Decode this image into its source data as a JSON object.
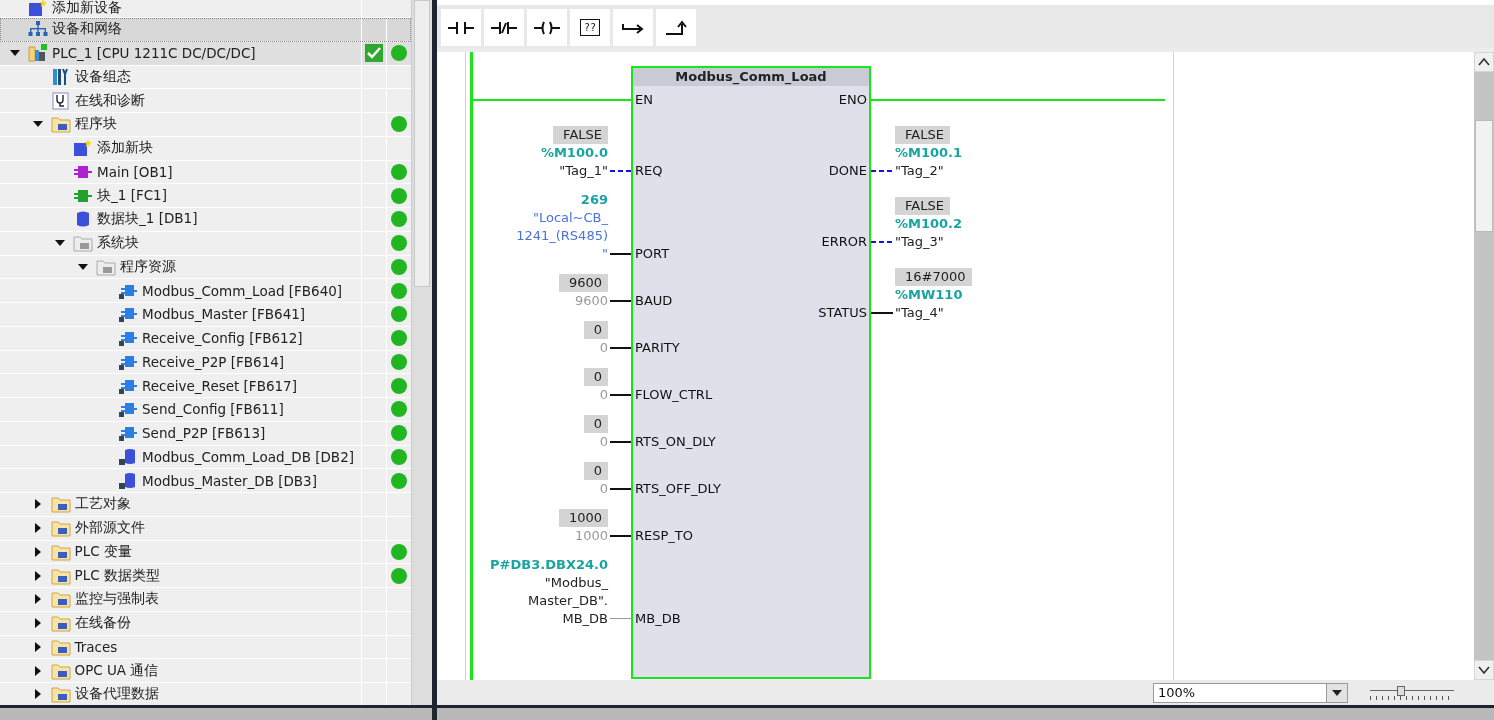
{
  "project_tree": {
    "items": [
      {
        "label": "添加新设备",
        "kind": "add",
        "selected": false
      },
      {
        "label": "设备和网络",
        "kind": "network",
        "selected": true
      },
      {
        "label": "PLC_1 [CPU 1211C DC/DC/DC]",
        "kind": "device",
        "selected": false,
        "expanded": true,
        "consistent": true,
        "online": true,
        "children": [
          {
            "label": "设备组态",
            "kind": "config",
            "selected": false
          },
          {
            "label": "在线和诊断",
            "kind": "diag",
            "selected": false
          },
          {
            "label": "程序块",
            "kind": "folder",
            "selected": false,
            "expanded": true,
            "online": true,
            "children": [
              {
                "label": "添加新块",
                "kind": "add",
                "selected": false
              },
              {
                "label": "Main [OB1]",
                "kind": "ob",
                "selected": false,
                "online": true
              },
              {
                "label": "块_1 [FC1]",
                "kind": "fc",
                "selected": false,
                "online": true
              },
              {
                "label": "数据块_1 [DB1]",
                "kind": "db",
                "selected": false,
                "online": true
              },
              {
                "label": "系统块",
                "kind": "sysfolder",
                "selected": false,
                "expanded": true,
                "online": true,
                "children": [
                  {
                    "label": "程序资源",
                    "kind": "sysfolder",
                    "selected": false,
                    "expanded": true,
                    "online": true,
                    "children": [
                      {
                        "label": "Modbus_Comm_Load [FB640]",
                        "kind": "fb",
                        "selected": false,
                        "online": true
                      },
                      {
                        "label": "Modbus_Master [FB641]",
                        "kind": "fb",
                        "selected": false,
                        "online": true
                      },
                      {
                        "label": "Receive_Config [FB612]",
                        "kind": "fb",
                        "selected": false,
                        "online": true
                      },
                      {
                        "label": "Receive_P2P [FB614]",
                        "kind": "fb",
                        "selected": false,
                        "online": true
                      },
                      {
                        "label": "Receive_Reset [FB617]",
                        "kind": "fb",
                        "selected": false,
                        "online": true
                      },
                      {
                        "label": "Send_Config [FB611]",
                        "kind": "fb",
                        "selected": false,
                        "online": true
                      },
                      {
                        "label": "Send_P2P [FB613]",
                        "kind": "fb",
                        "selected": false,
                        "online": true
                      },
                      {
                        "label": "Modbus_Comm_Load_DB [DB2]",
                        "kind": "idb",
                        "selected": false,
                        "online": true
                      },
                      {
                        "label": "Modbus_Master_DB [DB3]",
                        "kind": "idb",
                        "selected": false,
                        "online": true
                      }
                    ]
                  }
                ]
              }
            ]
          },
          {
            "label": "工艺对象",
            "kind": "folder",
            "selected": false,
            "expanded": false
          },
          {
            "label": "外部源文件",
            "kind": "folder",
            "selected": false,
            "expanded": false
          },
          {
            "label": "PLC 变量",
            "kind": "folder",
            "selected": false,
            "expanded": false,
            "online": true
          },
          {
            "label": "PLC 数据类型",
            "kind": "folder",
            "selected": false,
            "expanded": false,
            "online": true
          },
          {
            "label": "监控与强制表",
            "kind": "folder",
            "selected": false,
            "expanded": false
          },
          {
            "label": "在线备份",
            "kind": "folder",
            "selected": false,
            "expanded": false
          },
          {
            "label": "Traces",
            "kind": "folder",
            "selected": false,
            "expanded": false
          },
          {
            "label": "OPC UA 通信",
            "kind": "folder",
            "selected": false,
            "expanded": false
          },
          {
            "label": "设备代理数据",
            "kind": "folder",
            "selected": false,
            "expanded": false
          }
        ]
      }
    ]
  },
  "toolbar": [
    {
      "kind": "no_contact"
    },
    {
      "kind": "nc_contact"
    },
    {
      "kind": "coil"
    },
    {
      "kind": "empty_box",
      "label": "??"
    },
    {
      "kind": "open_branch"
    },
    {
      "kind": "close_branch"
    }
  ],
  "block": {
    "title": "Modbus_Comm_Load",
    "en": "EN",
    "eno": "ENO",
    "inputs": [
      {
        "pin": "REQ",
        "dashed": true,
        "dimmed": false,
        "lines": [
          {
            "text": "FALSE",
            "kind": "value"
          },
          {
            "text": "%M100.0",
            "kind": "address"
          },
          {
            "text": "\"Tag_1\"",
            "kind": "tag"
          }
        ]
      },
      {
        "pin": "PORT",
        "dashed": false,
        "dimmed": false,
        "lines": [
          {
            "text": "269",
            "kind": "address"
          },
          {
            "text": "\"Local~CB_",
            "kind": "constant"
          },
          {
            "text": "1241_(RS485)",
            "kind": "constant"
          },
          {
            "text": "\"",
            "kind": "constant"
          }
        ]
      },
      {
        "pin": "BAUD",
        "dashed": false,
        "dimmed": false,
        "lines": [
          {
            "text": "9600",
            "kind": "value"
          },
          {
            "text": "9600",
            "kind": "default"
          }
        ]
      },
      {
        "pin": "PARITY",
        "dashed": false,
        "dimmed": false,
        "lines": [
          {
            "text": "0",
            "kind": "value"
          },
          {
            "text": "0",
            "kind": "default"
          }
        ]
      },
      {
        "pin": "FLOW_CTRL",
        "dashed": false,
        "dimmed": false,
        "lines": [
          {
            "text": "0",
            "kind": "value"
          },
          {
            "text": "0",
            "kind": "default"
          }
        ]
      },
      {
        "pin": "RTS_ON_DLY",
        "dashed": false,
        "dimmed": false,
        "lines": [
          {
            "text": "0",
            "kind": "value"
          },
          {
            "text": "0",
            "kind": "default"
          }
        ]
      },
      {
        "pin": "RTS_OFF_DLY",
        "dashed": false,
        "dimmed": false,
        "lines": [
          {
            "text": "0",
            "kind": "value"
          },
          {
            "text": "0",
            "kind": "default"
          }
        ]
      },
      {
        "pin": "RESP_TO",
        "dashed": false,
        "dimmed": false,
        "lines": [
          {
            "text": "1000",
            "kind": "value"
          },
          {
            "text": "1000",
            "kind": "default"
          }
        ]
      },
      {
        "pin": "MB_DB",
        "dashed": false,
        "dimmed": true,
        "lines": [
          {
            "text": "P#DB3.DBX24.0",
            "kind": "address"
          },
          {
            "text": "\"Modbus_",
            "kind": "tag"
          },
          {
            "text": "Master_DB\".",
            "kind": "tag"
          },
          {
            "text": "MB_DB",
            "kind": "tag"
          }
        ]
      }
    ],
    "outputs": [
      {
        "pin": "DONE",
        "dashed": true,
        "dimmed": false,
        "lines": [
          {
            "text": "FALSE",
            "kind": "value"
          },
          {
            "text": "%M100.1",
            "kind": "address"
          },
          {
            "text": "\"Tag_2\"",
            "kind": "tag"
          }
        ]
      },
      {
        "pin": "ERROR",
        "dashed": true,
        "dimmed": false,
        "lines": [
          {
            "text": "FALSE",
            "kind": "value"
          },
          {
            "text": "%M100.2",
            "kind": "address"
          },
          {
            "text": "\"Tag_3\"",
            "kind": "tag"
          }
        ]
      },
      {
        "pin": "STATUS",
        "dashed": false,
        "dimmed": false,
        "lines": [
          {
            "text": "16#7000",
            "kind": "value"
          },
          {
            "text": "%MW110",
            "kind": "address"
          },
          {
            "text": "\"Tag_4\"",
            "kind": "tag"
          }
        ]
      }
    ]
  },
  "zoom": {
    "value": "100%",
    "level": 0.35
  }
}
